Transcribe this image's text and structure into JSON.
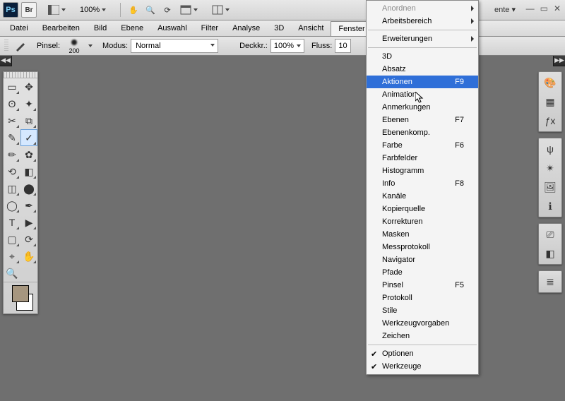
{
  "topbar": {
    "zoom": "100%",
    "workspace_label": "ente ▾"
  },
  "menubar": {
    "items": [
      "Datei",
      "Bearbeiten",
      "Bild",
      "Ebene",
      "Auswahl",
      "Filter",
      "Analyse",
      "3D",
      "Ansicht",
      "Fenster"
    ],
    "active_index": 9
  },
  "optbar": {
    "brush_label": "Pinsel:",
    "brush_size": "200",
    "mode_label": "Modus:",
    "mode_value": "Normal",
    "opacity_label": "Deckkr.:",
    "opacity_value": "100%",
    "flow_label": "Fluss:",
    "flow_value": "10"
  },
  "dropdown": {
    "items": [
      {
        "label": "Anordnen",
        "sub": true,
        "disabled": true
      },
      {
        "label": "Arbeitsbereich",
        "sub": true
      },
      {
        "sep": true
      },
      {
        "label": "Erweiterungen",
        "sub": true
      },
      {
        "sep": true
      },
      {
        "label": "3D"
      },
      {
        "label": "Absatz"
      },
      {
        "label": "Aktionen",
        "shortcut": "F9",
        "highlight": true
      },
      {
        "label": "Animation"
      },
      {
        "label": "Anmerkungen"
      },
      {
        "label": "Ebenen",
        "shortcut": "F7"
      },
      {
        "label": "Ebenenkomp."
      },
      {
        "label": "Farbe",
        "shortcut": "F6"
      },
      {
        "label": "Farbfelder"
      },
      {
        "label": "Histogramm"
      },
      {
        "label": "Info",
        "shortcut": "F8"
      },
      {
        "label": "Kanäle"
      },
      {
        "label": "Kopierquelle"
      },
      {
        "label": "Korrekturen"
      },
      {
        "label": "Masken"
      },
      {
        "label": "Messprotokoll"
      },
      {
        "label": "Navigator"
      },
      {
        "label": "Pfade"
      },
      {
        "label": "Pinsel",
        "shortcut": "F5"
      },
      {
        "label": "Protokoll"
      },
      {
        "label": "Stile"
      },
      {
        "label": "Werkzeugvorgaben"
      },
      {
        "label": "Zeichen"
      },
      {
        "sep": true
      },
      {
        "label": "Optionen",
        "checked": true
      },
      {
        "label": "Werkzeuge",
        "checked": true
      }
    ]
  }
}
